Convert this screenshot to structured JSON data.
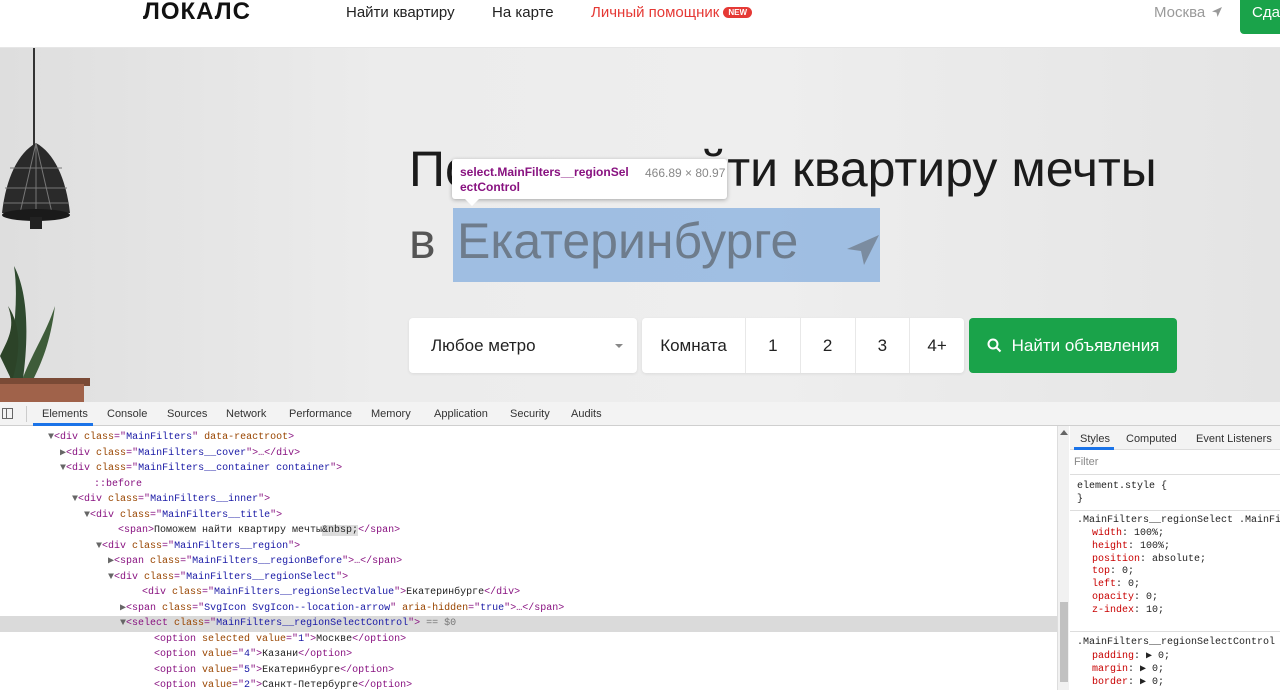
{
  "header": {
    "logo": "ЛОКАЛС",
    "nav": [
      "Найти квартиру",
      "На карте",
      "Личный помощник"
    ],
    "new_badge": "NEW",
    "city": "Москва",
    "post_button": "Сдать"
  },
  "hero": {
    "title_line1": "Поможем найти квартиру мечты",
    "title_prefix": "в",
    "region": "Екатеринбурге",
    "tooltip": {
      "selector": "select.MainFilters__regionSelectControl",
      "size": "466.89 × 80.97"
    }
  },
  "filters": {
    "metro": "Любое метро",
    "room_label": "Комната",
    "rooms": [
      "1",
      "2",
      "3",
      "4+"
    ],
    "search_button": "Найти объявления"
  },
  "devtools": {
    "tabs": [
      "Elements",
      "Console",
      "Sources",
      "Network",
      "Performance",
      "Memory",
      "Application",
      "Security",
      "Audits"
    ],
    "active_tab": "Elements",
    "dom_lines": [
      {
        "indent": 4,
        "tri": "▼",
        "tag": "div",
        "attrs": [
          [
            "class",
            "MainFilters"
          ],
          [
            "data-reactroot",
            ""
          ]
        ],
        "tail": ">"
      },
      {
        "indent": 5,
        "tri": "▶",
        "tag": "div",
        "attrs": [
          [
            "class",
            "MainFilters__cover"
          ]
        ],
        "tail": ">…</div>"
      },
      {
        "indent": 5,
        "tri": "▼",
        "tag": "div",
        "attrs": [
          [
            "class",
            "MainFilters__container container"
          ]
        ],
        "tail": ">"
      },
      {
        "indent": 7,
        "tri": "",
        "pseudo": "::before"
      },
      {
        "indent": 6,
        "tri": "▼",
        "tag": "div",
        "attrs": [
          [
            "class",
            "MainFilters__inner"
          ]
        ],
        "tail": ">"
      },
      {
        "indent": 7,
        "tri": "▼",
        "tag": "div",
        "attrs": [
          [
            "class",
            "MainFilters__title"
          ]
        ],
        "tail": ">"
      },
      {
        "indent": 9,
        "tri": "",
        "raw_open": "<span>",
        "text": "Поможем найти квартиру мечты",
        "entity": "&nbsp;",
        "raw_close": "</span>"
      },
      {
        "indent": 8,
        "tri": "▼",
        "tag": "div",
        "attrs": [
          [
            "class",
            "MainFilters__region"
          ]
        ],
        "tail": ">"
      },
      {
        "indent": 9,
        "tri": "▶",
        "tag": "span",
        "attrs": [
          [
            "class",
            "MainFilters__regionBefore"
          ]
        ],
        "tail": ">…</span>"
      },
      {
        "indent": 9,
        "tri": "▼",
        "tag": "div",
        "attrs": [
          [
            "class",
            "MainFilters__regionSelect"
          ]
        ],
        "tail": ">"
      },
      {
        "indent": 11,
        "tri": "",
        "tag": "div",
        "attrs": [
          [
            "class",
            "MainFilters__regionSelectValue"
          ]
        ],
        "tail": ">",
        "text": "Екатеринбурге",
        "close": "</div>"
      },
      {
        "indent": 10,
        "tri": "▶",
        "tag": "span",
        "attrs": [
          [
            "class",
            "SvgIcon SvgIcon--location-arrow"
          ],
          [
            "aria-hidden",
            "true"
          ]
        ],
        "tail": ">…</span>"
      },
      {
        "indent": 10,
        "tri": "▼",
        "tag": "select",
        "attrs": [
          [
            "class",
            "MainFilters__regionSelectControl"
          ]
        ],
        "tail": ">",
        "selected": true,
        "eq": "== $0"
      },
      {
        "indent": 12,
        "tri": "",
        "tag": "option",
        "attrs": [
          [
            "selected",
            ""
          ],
          [
            "value",
            "1"
          ]
        ],
        "tail": ">",
        "text": "Москве",
        "close": "</option>"
      },
      {
        "indent": 12,
        "tri": "",
        "tag": "option",
        "attrs": [
          [
            "value",
            "4"
          ]
        ],
        "tail": ">",
        "text": "Казани",
        "close": "</option>"
      },
      {
        "indent": 12,
        "tri": "",
        "tag": "option",
        "attrs": [
          [
            "value",
            "5"
          ]
        ],
        "tail": ">",
        "text": "Екатеринбурге",
        "close": "</option>"
      },
      {
        "indent": 12,
        "tri": "",
        "tag": "option",
        "attrs": [
          [
            "value",
            "2"
          ]
        ],
        "tail": ">",
        "text": "Санкт-Петербурге",
        "close": "</option>"
      }
    ],
    "styles_panel": {
      "tabs": [
        "Styles",
        "Computed",
        "Event Listeners"
      ],
      "filter_placeholder": "Filter",
      "element_style": "element.style {",
      "close_brace": "}",
      "rule1_selector": ".MainFilters__regionSelect .MainFi",
      "rule1_props": [
        [
          "width",
          "100%;"
        ],
        [
          "height",
          "100%;"
        ],
        [
          "position",
          "absolute;"
        ],
        [
          "top",
          "0;"
        ],
        [
          "left",
          "0;"
        ],
        [
          "opacity",
          "0;"
        ],
        [
          "z-index",
          "10;"
        ]
      ],
      "rule2_selector": ".MainFilters__regionSelectControl",
      "rule2_props": [
        [
          "padding",
          "▶ 0;"
        ],
        [
          "margin",
          "▶ 0;"
        ],
        [
          "border",
          "▶ 0;"
        ]
      ]
    }
  },
  "colors": {
    "brand_green": "#1aa34a",
    "accent_red": "#e53935",
    "highlight": "#6fa1dc"
  }
}
